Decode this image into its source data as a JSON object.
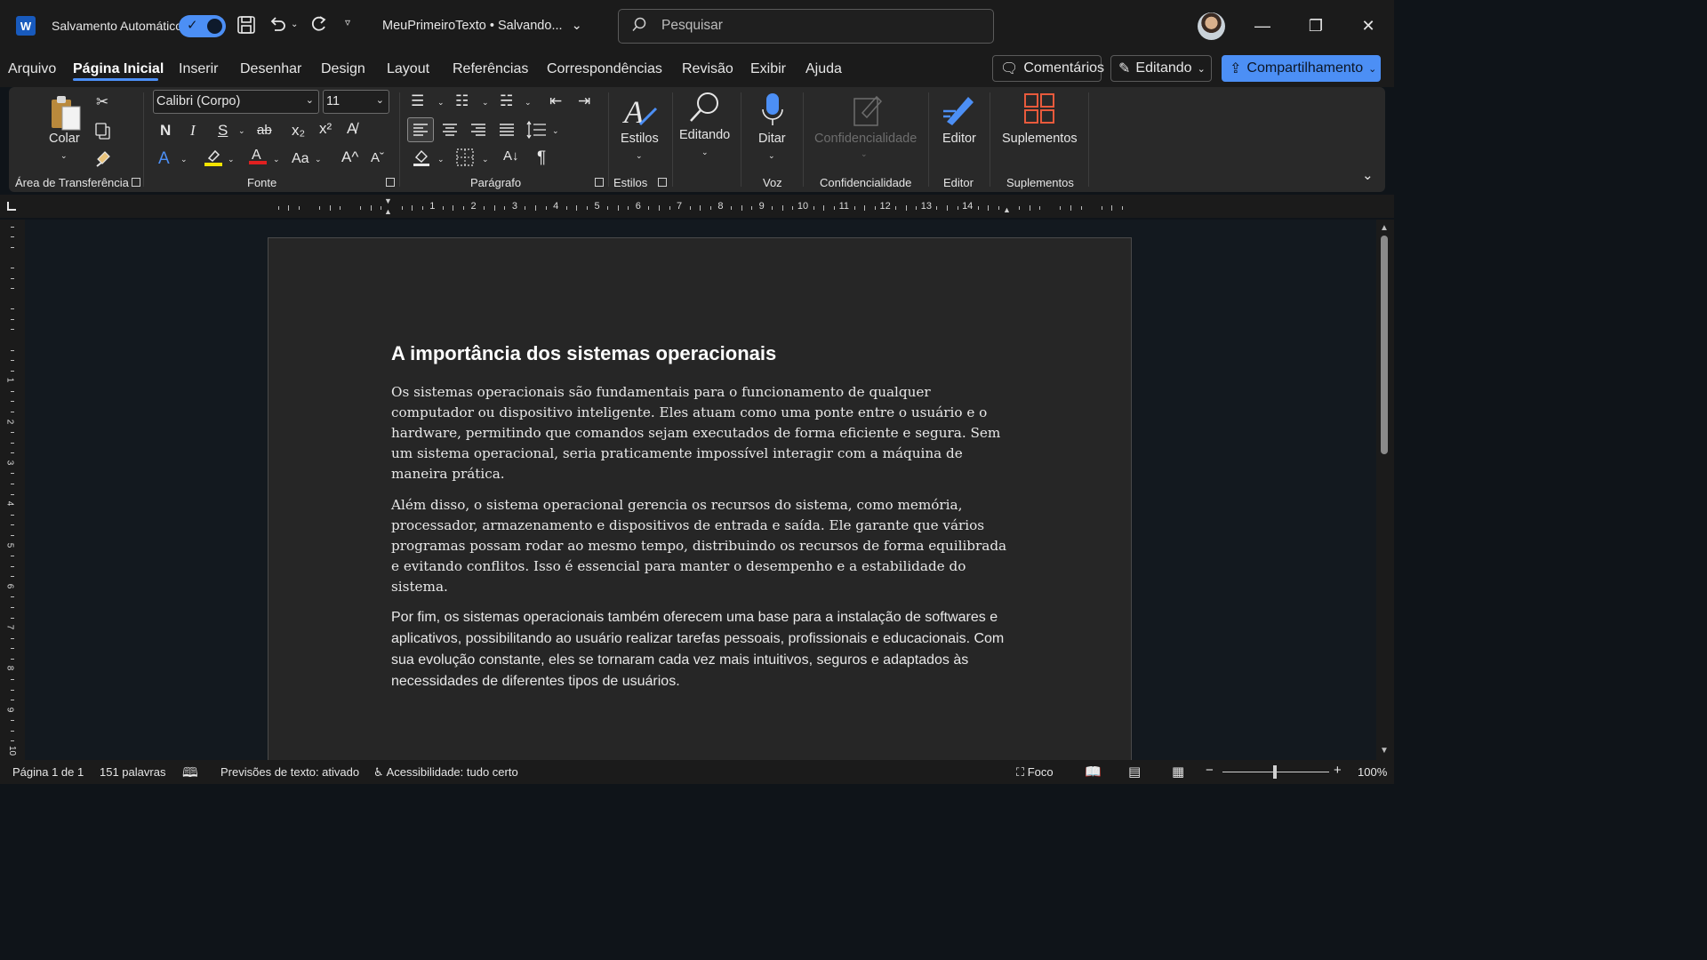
{
  "titlebar": {
    "app_icon": "W",
    "autosave_label": "Salvamento Automático",
    "autosave_on": true,
    "doc_title": "MeuPrimeiroTexto • Salvando...",
    "search_placeholder": "Pesquisar"
  },
  "menu": {
    "tabs": [
      "Arquivo",
      "Página Inicial",
      "Inserir",
      "Desenhar",
      "Design",
      "Layout",
      "Referências",
      "Correspondências",
      "Revisão",
      "Exibir",
      "Ajuda"
    ],
    "active_tab": "Página Inicial",
    "comments_label": "Comentários",
    "editing_label": "Editando",
    "share_label": "Compartilhamento"
  },
  "ribbon": {
    "clipboard": {
      "paste_label": "Colar",
      "group_label": "Área de Transferência"
    },
    "font": {
      "font_name": "Calibri (Corpo)",
      "font_size": "11",
      "bold": "N",
      "italic": "I",
      "underline": "S",
      "strike": "ab",
      "subscript": "x₂",
      "superscript": "x²",
      "change_case": "Aa",
      "grow": "A^",
      "shrink": "Aˇ",
      "group_label": "Fonte"
    },
    "paragraph": {
      "group_label": "Parágrafo",
      "pilcrow": "¶"
    },
    "styles": {
      "label": "Estilos",
      "group_label": "Estilos"
    },
    "editing": {
      "label": "Editando"
    },
    "voice": {
      "label": "Ditar",
      "group_label": "Voz"
    },
    "sensitivity": {
      "label": "Confidencialidade",
      "group_label": "Confidencialidade"
    },
    "editor": {
      "label": "Editor",
      "group_label": "Editor"
    },
    "addins": {
      "label": "Suplementos",
      "group_label": "Suplementos"
    }
  },
  "ruler": {
    "numbers": [
      "1",
      "2",
      "3",
      "4",
      "5",
      "6",
      "7",
      "8",
      "9",
      "10",
      "11",
      "12",
      "13",
      "14"
    ],
    "vertical_numbers": [
      "1",
      "2",
      "3",
      "4",
      "5",
      "6",
      "7",
      "8",
      "9",
      "10"
    ]
  },
  "document": {
    "heading": "A importância dos sistemas operacionais",
    "paragraphs": [
      "Os sistemas operacionais são fundamentais para o funcionamento de qualquer computador ou dispositivo inteligente. Eles atuam como uma ponte entre o usuário e o hardware, permitindo que comandos sejam executados de forma eficiente e segura. Sem um sistema operacional, seria praticamente impossível interagir com a máquina de maneira prática.",
      "Além disso, o sistema operacional gerencia os recursos do sistema, como memória, processador, armazenamento e dispositivos de entrada e saída. Ele garante que vários programas possam rodar ao mesmo tempo, distribuindo os recursos de forma equilibrada e evitando conflitos. Isso é essencial para manter o desempenho e a estabilidade do sistema.",
      "Por fim, os sistemas operacionais também oferecem uma base para a instalação de softwares e aplicativos, possibilitando ao usuário realizar tarefas pessoais, profissionais e educacionais. Com sua evolução constante, eles se tornaram cada vez mais intuitivos, seguros e adaptados às necessidades de diferentes tipos de usuários."
    ]
  },
  "status": {
    "page": "Página 1 de 1",
    "words": "151 palavras",
    "text_predictions": "Previsões de texto: ativado",
    "accessibility": "Acessibilidade: tudo certo",
    "focus": "Foco",
    "zoom": "100%"
  },
  "colors": {
    "accent": "#4c8ff5",
    "word_brand": "#185abd",
    "background": "#0f1419",
    "page": "#262626",
    "ribbon": "#292929"
  }
}
